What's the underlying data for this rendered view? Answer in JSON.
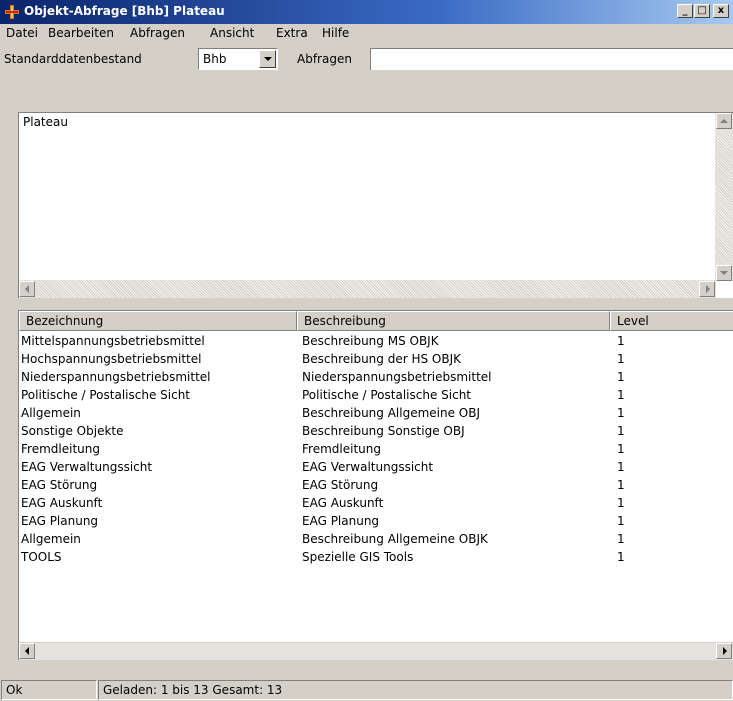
{
  "window": {
    "title": "Objekt-Abfrage [Bhb] Plateau",
    "min_glyph": "_",
    "max_glyph": "□",
    "close_glyph": "x"
  },
  "menu": [
    "Datei",
    "Bearbeiten",
    "Abfragen",
    "Ansicht",
    "Extra",
    "Hilfe"
  ],
  "toolbar": {
    "standard_label": "Standarddatenbestand",
    "standard_value": "Bhb",
    "query_label": "Abfragen",
    "query_value": ""
  },
  "text_area": {
    "content": "Plateau"
  },
  "list": {
    "columns": [
      "Bezeichnung",
      "Beschreibung",
      "Level"
    ],
    "rows": [
      [
        "Mittelspannungsbetriebsmittel",
        "Beschreibung MS OBJK",
        "1"
      ],
      [
        "Hochspannungsbetriebsmittel",
        "Beschreibung der HS OBJK",
        "1"
      ],
      [
        "Niederspannungsbetriebsmittel",
        "Niederspannungsbetriebsmittel",
        "1"
      ],
      [
        "Politische / Postalische Sicht",
        "Politische / Postalische Sicht",
        "1"
      ],
      [
        "Allgemein",
        "Beschreibung Allgemeine OBJ",
        "1"
      ],
      [
        "Sonstige Objekte",
        "Beschreibung Sonstige OBJ",
        "1"
      ],
      [
        "Fremdleitung",
        "Fremdleitung",
        "1"
      ],
      [
        "EAG Verwaltungssicht",
        "EAG Verwaltungssicht",
        "1"
      ],
      [
        "EAG Störung",
        "EAG Störung",
        "1"
      ],
      [
        "EAG Auskunft",
        "EAG Auskunft",
        "1"
      ],
      [
        "EAG Planung",
        "EAG Planung",
        "1"
      ],
      [
        "Allgemein",
        "Beschreibung Allgemeine OBJK",
        "1"
      ],
      [
        "TOOLS",
        "Spezielle GIS Tools",
        "1"
      ]
    ]
  },
  "status": {
    "state": "Ok",
    "info": "Geladen: 1 bis 13 Gesamt: 13"
  },
  "colors": {
    "titlebar_start": "#0a246a",
    "titlebar_end": "#a6caf0",
    "face": "#d4d0c8",
    "window_bg": "#ffffff"
  }
}
